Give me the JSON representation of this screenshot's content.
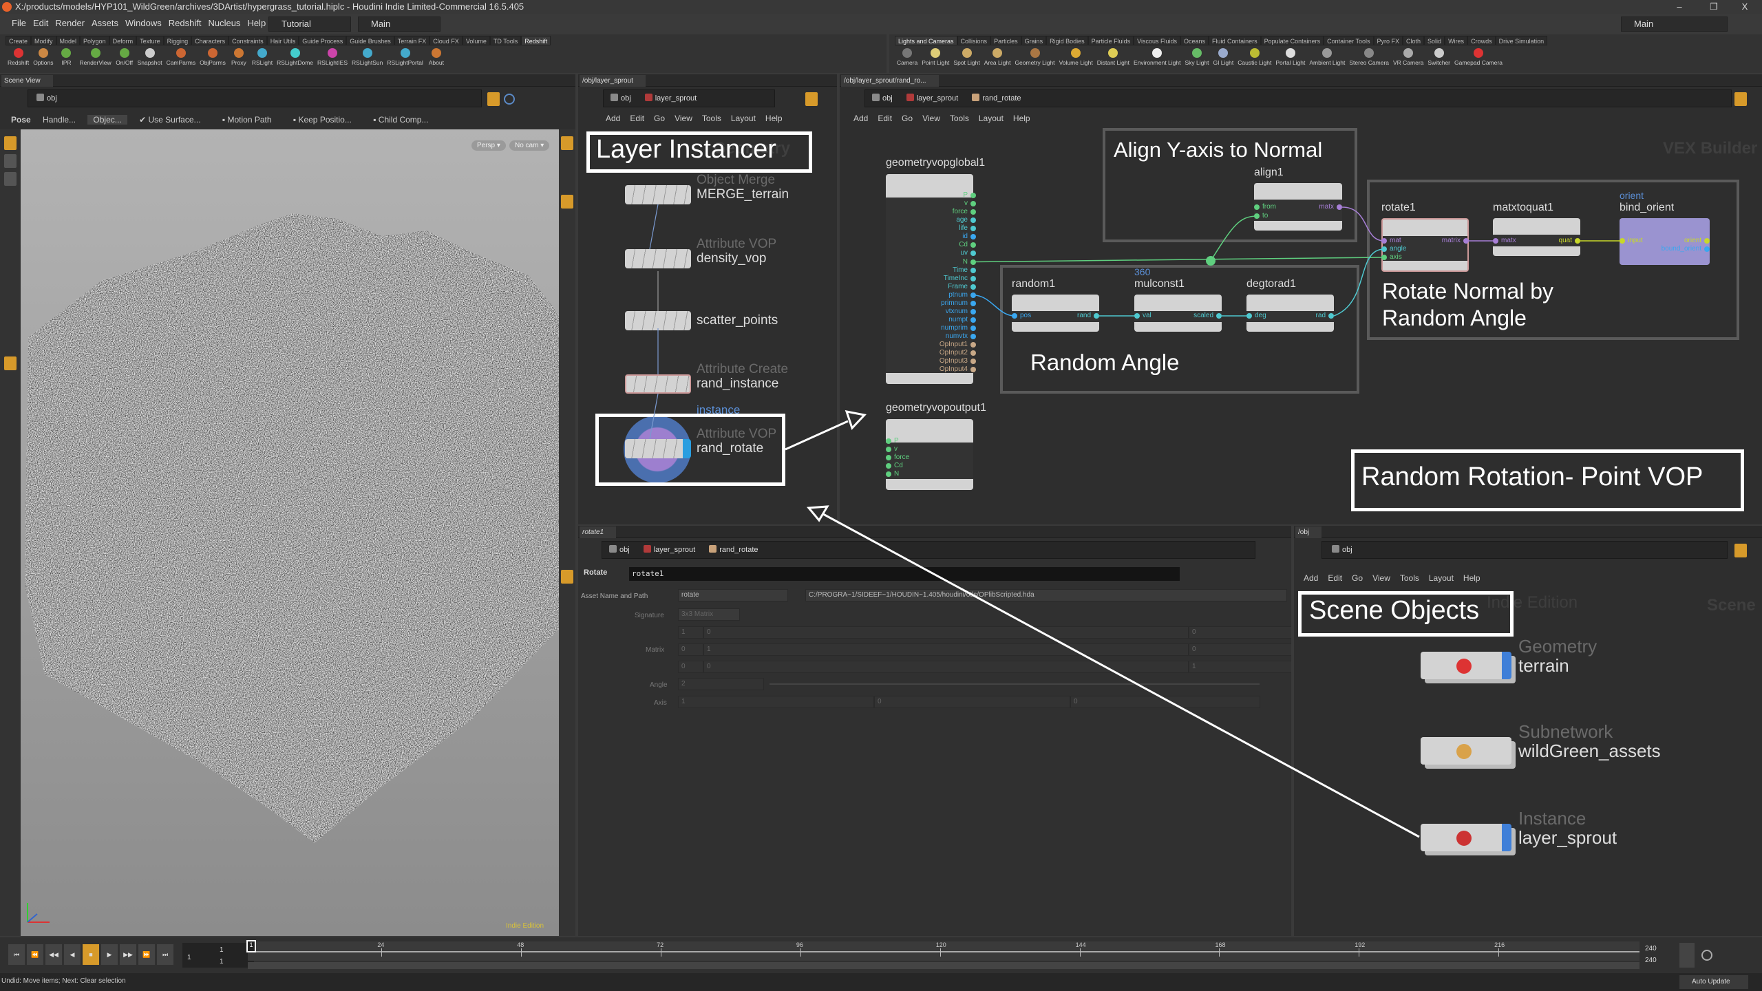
{
  "window": {
    "title": "X:/products/models/HYP101_WildGreen/archives/3DArtist/hypergrass_tutorial.hiplc - Houdini Indie Limited-Commercial 16.5.405",
    "minimize": "–",
    "maximize": "❐",
    "close": "X"
  },
  "menu": [
    "File",
    "Edit",
    "Render",
    "Assets",
    "Windows",
    "Redshift",
    "Nucleus",
    "Help"
  ],
  "desktop": {
    "left": "Tutorial",
    "main": "Main",
    "right": "Main"
  },
  "shelf_left": {
    "active": "Redshift",
    "tabs": [
      "Create",
      "Modify",
      "Model",
      "Polygon",
      "Deform",
      "Texture",
      "Rigging",
      "Characters",
      "Constraints",
      "Hair Utils",
      "Guide Process",
      "Guide Brushes",
      "Terrain FX",
      "Cloud FX",
      "Volume",
      "TD Tools",
      "Redshift"
    ],
    "tools": [
      "Redshift",
      "Options",
      "IPR",
      "RenderView",
      "On/Off",
      "Snapshot",
      "CamParms",
      "ObjParms",
      "Proxy",
      "RSLight",
      "RSLightDome",
      "RSLightIES",
      "RSLightSun",
      "RSLightPortal",
      "About"
    ]
  },
  "shelf_right": {
    "active": "Lights and Cameras",
    "tabs": [
      "Lights and Cameras",
      "Collisions",
      "Particles",
      "Grains",
      "Rigid Bodies",
      "Particle Fluids",
      "Viscous Fluids",
      "Oceans",
      "Fluid Containers",
      "Populate Containers",
      "Container Tools",
      "Pyro FX",
      "Cloth",
      "Solid",
      "Wires",
      "Crowds",
      "Drive Simulation"
    ],
    "tools": [
      "Camera",
      "Point Light",
      "Spot Light",
      "Area Light",
      "Geometry Light",
      "Volume Light",
      "Distant Light",
      "Environment Light",
      "Sky Light",
      "GI Light",
      "Caustic Light",
      "Portal Light",
      "Ambient Light",
      "Stereo Camera",
      "VR Camera",
      "Switcher",
      "Gamepad Camera"
    ]
  },
  "scene_view": {
    "tab": "Scene View",
    "path": "obj",
    "toolbar": {
      "pose": "Pose",
      "handle": "Handle...",
      "object": "Objec...",
      "use_surface": "Use Surface...",
      "motion_path": "Motion Path",
      "keep_position": "Keep Positio...",
      "child_comp": "Child Comp..."
    },
    "persp": "Persp ▾",
    "cam": "No cam ▾",
    "watermark": "Indie Edition"
  },
  "sop_net": {
    "tab": "/obj/layer_sprout",
    "path": [
      "obj",
      "layer_sprout"
    ],
    "menu": [
      "Add",
      "Edit",
      "Go",
      "View",
      "Tools",
      "Layout",
      "Help"
    ],
    "context": "Geometry",
    "nodes": [
      {
        "type": "Object Merge",
        "name": "MERGE_terrain"
      },
      {
        "type": "Attribute VOP",
        "name": "density_vop"
      },
      {
        "type": "",
        "name": "scatter_points"
      },
      {
        "type": "Attribute Create",
        "name": "rand_instance",
        "comment": "instance"
      },
      {
        "type": "Attribute VOP",
        "name": "rand_rotate"
      }
    ]
  },
  "vop_net": {
    "tab": "/obj/layer_sprout/rand_ro...",
    "path": [
      "obj",
      "layer_sprout",
      "rand_rotate"
    ],
    "menu": [
      "Add",
      "Edit",
      "Go",
      "View",
      "Tools",
      "Layout",
      "Help"
    ],
    "context": "VEX Builder",
    "global": {
      "name": "geometryvopglobal1",
      "outputs": [
        "P",
        "v",
        "force",
        "age",
        "life",
        "id",
        "Cd",
        "uv",
        "N",
        "Time",
        "TimeInc",
        "Frame",
        "ptnum",
        "primnum",
        "vtxnum",
        "numpt",
        "numprim",
        "numvtx",
        "OpInput1",
        "OpInput2",
        "OpInput3",
        "OpInput4"
      ]
    },
    "output": {
      "name": "geometryvopoutput1",
      "inputs": [
        "P",
        "v",
        "force",
        "Cd",
        "N"
      ]
    },
    "align": {
      "name": "align1",
      "inputs": [
        "from",
        "to"
      ],
      "output": "matx"
    },
    "random": {
      "name": "random1",
      "input": "pos",
      "output": "rand"
    },
    "mulconst": {
      "name": "mulconst1",
      "comment": "360",
      "input": "val",
      "output": "scaled"
    },
    "degtorad": {
      "name": "degtorad1",
      "input": "deg",
      "output": "rad"
    },
    "rotate": {
      "name": "rotate1",
      "inputs": [
        "mat",
        "angle",
        "axis"
      ],
      "output": "matrix"
    },
    "matxtoquat": {
      "name": "matxtoquat1",
      "input": "matx",
      "output": "quat"
    },
    "bind": {
      "name": "bind_orient",
      "comment": "orient",
      "input": "input",
      "outputs": [
        "orient",
        "bound_orient"
      ]
    }
  },
  "annotations": {
    "layer_instancer": "Layer Instancer",
    "align": "Align Y-axis to Normal",
    "random_angle": "Random Angle",
    "rotate_line1": "Rotate Normal by",
    "rotate_line2": "Random Angle",
    "point_vop": "Random Rotation- Point VOP",
    "scene_objects": "Scene Objects"
  },
  "params": {
    "tab": "rotate1",
    "path": [
      "obj",
      "layer_sprout",
      "rand_rotate"
    ],
    "op_type": "Rotate",
    "node_name": "rotate1",
    "asset_label": "Asset Name and Path",
    "asset_name": "rotate",
    "asset_path": "C:/PROGRA~1/SIDEEF~1/HOUDIN~1.405/houdini/otls/OPlibScripted.hda",
    "signature_label": "Signature",
    "signature": "3x3 Matrix",
    "matrix_label": "Matrix",
    "matrix": [
      [
        "1",
        "0",
        "0"
      ],
      [
        "0",
        "1",
        "0"
      ],
      [
        "0",
        "0",
        "1"
      ]
    ],
    "angle_label": "Angle",
    "angle": "2",
    "axis_label": "Axis",
    "axis": [
      "1",
      "0",
      "0"
    ]
  },
  "scene_net": {
    "tab": "/obj",
    "path": "obj",
    "menu": [
      "Add",
      "Edit",
      "Go",
      "View",
      "Tools",
      "Layout",
      "Help"
    ],
    "watermark": "Indie Edition",
    "context": "Scene",
    "nodes": [
      {
        "type": "Geometry",
        "name": "terrain"
      },
      {
        "type": "Subnetwork",
        "name": "wildGreen_assets"
      },
      {
        "type": "Instance",
        "name": "layer_sprout"
      }
    ]
  },
  "timeline": {
    "current": "1",
    "start": "1",
    "range_start": "1",
    "end": "240",
    "range_end": "240",
    "ticks": [
      "24",
      "48",
      "72",
      "96",
      "120",
      "144",
      "168",
      "192",
      "216"
    ],
    "first": 1,
    "last": 240
  },
  "status": {
    "message": "Undid: Move items; Next: Clear selection",
    "auto_update": "Auto Update"
  },
  "colors": {
    "accent": "#d79a2a",
    "port_green": "#5fcf7f",
    "port_cyan": "#4fc9d0",
    "port_blue": "#3aa7f0",
    "port_tan": "#c8a887",
    "port_purple": "#a77fd6",
    "port_yellow": "#c8d82a",
    "bind_node": "#9a93d0"
  }
}
